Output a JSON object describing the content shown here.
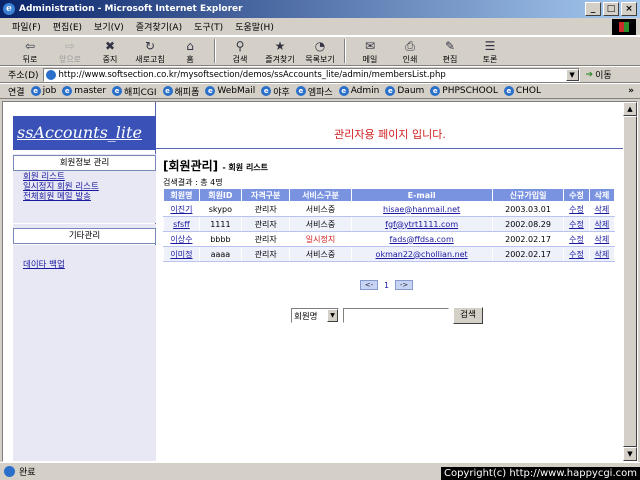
{
  "window": {
    "title": "Administration - Microsoft Internet Explorer",
    "buttons": [
      "_",
      "□",
      "×"
    ]
  },
  "menu": [
    "파일(F)",
    "편집(E)",
    "보기(V)",
    "즐겨찾기(A)",
    "도구(T)",
    "도움말(H)"
  ],
  "toolbar": [
    {
      "label": "뒤로",
      "icon": "back-arrow-icon",
      "glyph": "⇦",
      "disabled": false
    },
    {
      "label": "앞으로",
      "icon": "forward-arrow-icon",
      "glyph": "⇨",
      "disabled": true
    },
    {
      "label": "중지",
      "icon": "stop-icon",
      "glyph": "✖",
      "disabled": false
    },
    {
      "label": "새로고침",
      "icon": "refresh-icon",
      "glyph": "↻",
      "disabled": false
    },
    {
      "label": "홈",
      "icon": "home-icon",
      "glyph": "⌂",
      "disabled": false
    },
    {
      "label": "검색",
      "icon": "search-icon",
      "glyph": "⚲",
      "disabled": false
    },
    {
      "label": "즐겨찾기",
      "icon": "favorites-icon",
      "glyph": "★",
      "disabled": false
    },
    {
      "label": "목록보기",
      "icon": "history-icon",
      "glyph": "◔",
      "disabled": false
    },
    {
      "label": "메일",
      "icon": "mail-icon",
      "glyph": "✉",
      "disabled": false
    },
    {
      "label": "인쇄",
      "icon": "print-icon",
      "glyph": "⎙",
      "disabled": false
    },
    {
      "label": "편집",
      "icon": "edit-icon",
      "glyph": "✎",
      "disabled": false
    },
    {
      "label": "토론",
      "icon": "discuss-icon",
      "glyph": "☰",
      "disabled": false
    }
  ],
  "address": {
    "label": "주소(D)",
    "url": "http://www.softsection.co.kr/mysoftsection/demos/ssAccounts_lite/admin/membersList.php",
    "go_label": "이동"
  },
  "links": {
    "label": "연결",
    "items": [
      "job",
      "master",
      "해피CGI",
      "해피폼",
      "WebMail",
      "야후",
      "엠파스",
      "Admin",
      "Daum",
      "PHPSCHOOL",
      "CHOL"
    ],
    "more": "»"
  },
  "sidebar": {
    "logo": "ssAccounts_lite",
    "section1": "회원정보 관리",
    "links1": [
      "회원 리스트",
      "일시정지 회원 리스트",
      "전체회원 메일 발송"
    ],
    "section2": "기타관리",
    "links2": [
      "데이타 백업"
    ]
  },
  "main": {
    "admin_msg": "관리자용 페이지 입니다.",
    "title": "[회원관리]",
    "subtitle": "- 회원 리스트",
    "search_result": "검색결과 : 총 4명"
  },
  "table": {
    "headers": [
      "회원명",
      "회원ID",
      "자격구분",
      "서비스구분",
      "E-mail",
      "신규가입일",
      "수정",
      "삭제"
    ],
    "rows": [
      {
        "name": "이진기",
        "id": "skypo",
        "role": "관리자",
        "service": "서비스중",
        "service_red": false,
        "email": "hisae@hanmail.net",
        "date": "2003.03.01",
        "edit": "수정",
        "del": "삭제"
      },
      {
        "name": "sfsff",
        "id": "1111",
        "role": "관리자",
        "service": "서비스중",
        "service_red": false,
        "email": "fgf@ytrt1111.com",
        "date": "2002.08.29",
        "edit": "수정",
        "del": "삭제"
      },
      {
        "name": "이상수",
        "id": "bbbb",
        "role": "관리자",
        "service": "일시정지",
        "service_red": true,
        "email": "fads@ffdsa.com",
        "date": "2002.02.17",
        "edit": "수정",
        "del": "삭제"
      },
      {
        "name": "이미정",
        "id": "aaaa",
        "role": "관리자",
        "service": "서비스중",
        "service_red": false,
        "email": "okman22@chollian.net",
        "date": "2002.02.17",
        "edit": "수정",
        "del": "삭제"
      }
    ]
  },
  "pager": {
    "prev": "<-",
    "page": "1",
    "next": "->"
  },
  "search": {
    "field_select": "회원명",
    "query": "",
    "button": "검색"
  },
  "status": {
    "text": "완료",
    "copyright": "Copyright(c) http://www.happycgi.com"
  },
  "colors": {
    "accent": "#3a52b8",
    "header": "#7a93e0",
    "alert": "#d02020",
    "link": "#1a1aa0"
  }
}
